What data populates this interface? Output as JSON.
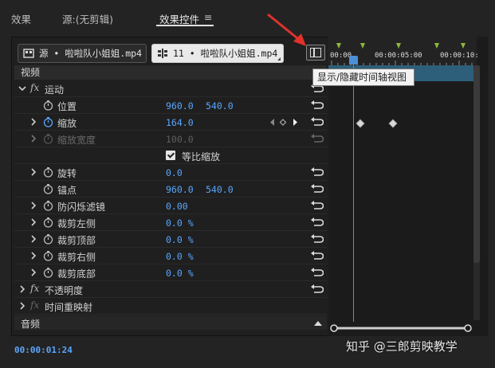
{
  "tabs": [
    {
      "label": "效果"
    },
    {
      "label": "源:(无剪辑)"
    },
    {
      "label": "效果控件"
    }
  ],
  "tab_menu_glyph": "≡",
  "clips": {
    "source": "源 • 啦啦队小姐姐.mp4",
    "sequence": "11 • 啦啦队小姐姐.mp4"
  },
  "toggle_timeline_tooltip": "显示/隐藏时间轴视图",
  "section_video": "视频",
  "section_audio": "音频",
  "effects": {
    "motion": "运动",
    "opacity": "不透明度",
    "time_remap": "时间重映射"
  },
  "props": [
    {
      "name": "位置",
      "v1": "960.0",
      "v2": "540.0"
    },
    {
      "name": "缩放",
      "v1": "164.0",
      "v2": ""
    },
    {
      "name": "缩放宽度",
      "v1": "100.0",
      "v2": ""
    },
    {
      "name": "等比缩放",
      "v1": "",
      "v2": ""
    },
    {
      "name": "旋转",
      "v1": "0.0",
      "v2": ""
    },
    {
      "name": "锚点",
      "v1": "960.0",
      "v2": "540.0"
    },
    {
      "name": "防闪烁滤镜",
      "v1": "0.00",
      "v2": ""
    },
    {
      "name": "裁剪左侧",
      "v1": "0.0 %",
      "v2": ""
    },
    {
      "name": "裁剪顶部",
      "v1": "0.0 %",
      "v2": ""
    },
    {
      "name": "裁剪右侧",
      "v1": "0.0 %",
      "v2": ""
    },
    {
      "name": "裁剪底部",
      "v1": "0.0 %",
      "v2": ""
    }
  ],
  "ruler_labels": [
    "00:00",
    "00:00:05:00",
    "00:00:10:"
  ],
  "timecode": "00:00:01:24",
  "watermark": "知乎 @三郎剪映教学",
  "colors": {
    "accent_blue": "#5aa7ff",
    "track_blue": "#2d5f7a",
    "arrow_red": "#e0322b"
  }
}
